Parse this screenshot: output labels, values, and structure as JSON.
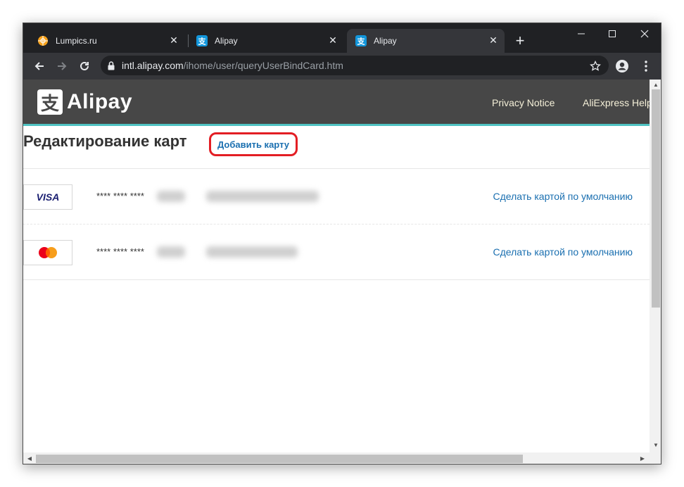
{
  "browser": {
    "tabs": [
      {
        "title": "Lumpics.ru",
        "icon": "orange-circle-icon"
      },
      {
        "title": "Alipay",
        "icon": "alipay-icon"
      },
      {
        "title": "Alipay",
        "icon": "alipay-icon",
        "active": true
      }
    ],
    "url_host": "intl.alipay.com",
    "url_path": "/ihome/user/queryUserBindCard.htm"
  },
  "header": {
    "logo_text": "Alipay",
    "logo_glyph": "支",
    "links": [
      "Privacy Notice",
      "AliExpress Help"
    ]
  },
  "main": {
    "page_title": "Редактирование карт",
    "add_card_label": "Добавить карту",
    "cards": [
      {
        "brand": "VISA",
        "masked_number": "**** **** ****",
        "action_label": "Сделать картой по умолчанию"
      },
      {
        "brand": "MasterCard",
        "masked_number": "**** **** ****",
        "action_label": "Сделать картой по умолчанию"
      }
    ]
  },
  "colors": {
    "header_bg": "#474747",
    "header_accent": "#4fc3c2",
    "link": "#1a6fb0",
    "highlight": "#e31e24"
  }
}
